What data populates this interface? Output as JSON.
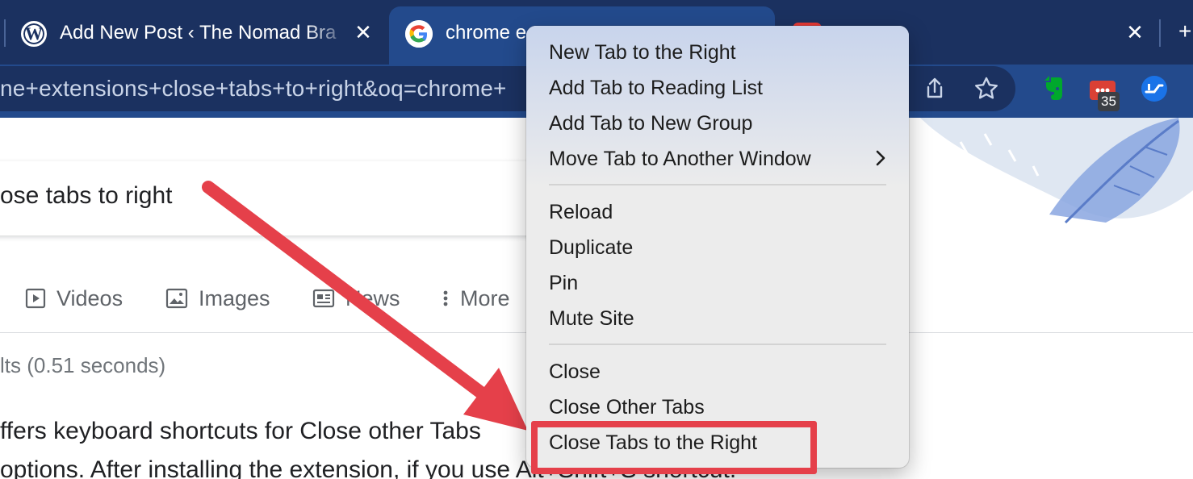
{
  "tabs": [
    {
      "title": "Add New Post ‹ The Nomad Bra",
      "icon": "wordpress-icon",
      "active": false
    },
    {
      "title": "chrome e",
      "icon": "google-icon",
      "active": true
    },
    {
      "title": "",
      "icon": "youtube-icon",
      "active": false
    }
  ],
  "toolbar": {
    "url_text": "ne+extensions+close+tabs+to+right&oq=chrome+",
    "extension_badge": "35"
  },
  "page": {
    "search_query": "ose tabs to right",
    "search_tabs": [
      {
        "label": "Videos",
        "icon": "video-icon"
      },
      {
        "label": "Images",
        "icon": "image-icon"
      },
      {
        "label": "News",
        "icon": "news-icon"
      },
      {
        "label": "More",
        "icon": "more-vertical-icon"
      }
    ],
    "result_stats": "lts (0.51 seconds)",
    "snippet_line_1": "ffers keyboard shortcuts for Close other Tabs",
    "snippet_line_2": "options. After installing the extension, if you use Alt+Shift+S shortcut."
  },
  "context_menu": {
    "groups": [
      [
        "New Tab to the Right",
        "Add Tab to Reading List",
        "Add Tab to New Group",
        "Move Tab to Another Window"
      ],
      [
        "Reload",
        "Duplicate",
        "Pin",
        "Mute Site"
      ],
      [
        "Close",
        "Close Other Tabs",
        "Close Tabs to the Right"
      ]
    ],
    "highlighted_item": "Close Tabs to the Right"
  },
  "colors": {
    "tab_strip": "#1b3160",
    "toolbar": "#234a8c",
    "highlight": "#e5404a",
    "arrow": "#e5404a"
  }
}
